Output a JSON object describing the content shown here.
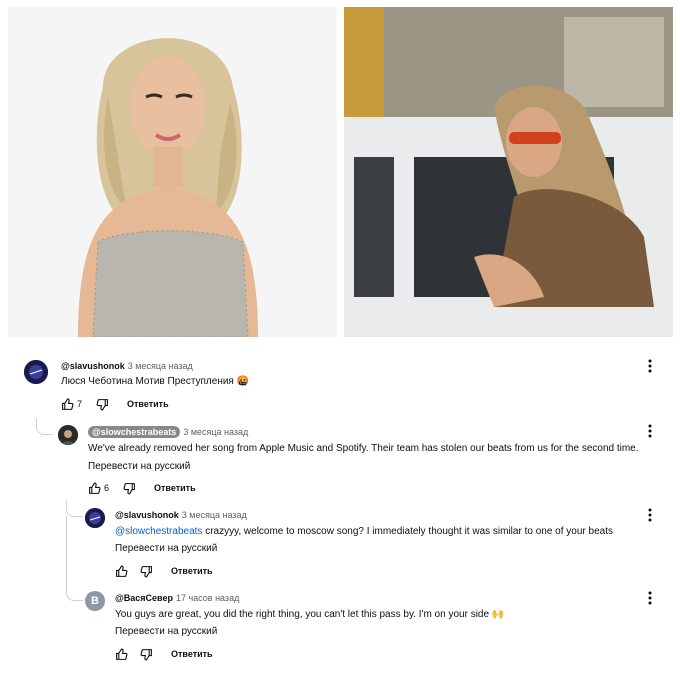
{
  "comments": [
    {
      "handle": "@slavushonok",
      "time": "3 месяца назад",
      "text": "Люся Чеботина Мотив Преступления 🤬",
      "likes": "7",
      "reply": "Ответить"
    },
    {
      "handle": "@slowchestrabeats",
      "time": "3 месяца назад",
      "text": "We've already removed her song from Apple Music and Spotify. Their team has stolen our beats from us for the second time.",
      "translate": "Перевести на русский",
      "likes": "6",
      "reply": "Ответить"
    },
    {
      "handle": "@slavushonok",
      "time": "3 месяца назад",
      "mention": "@slowchestrabeats",
      "text": "crazyyy, welcome to moscow song? I immediately thought it was similar to one of your beats",
      "translate": "Перевести на русский",
      "reply": "Ответить"
    },
    {
      "handle": "@ВасяСевер",
      "avatar_letter": "В",
      "time": "17 часов назад",
      "text": "You guys are great, you did the right thing, you can't let this pass by. I'm on your side 🙌",
      "translate": "Перевести на русский",
      "reply": "Ответить"
    }
  ]
}
